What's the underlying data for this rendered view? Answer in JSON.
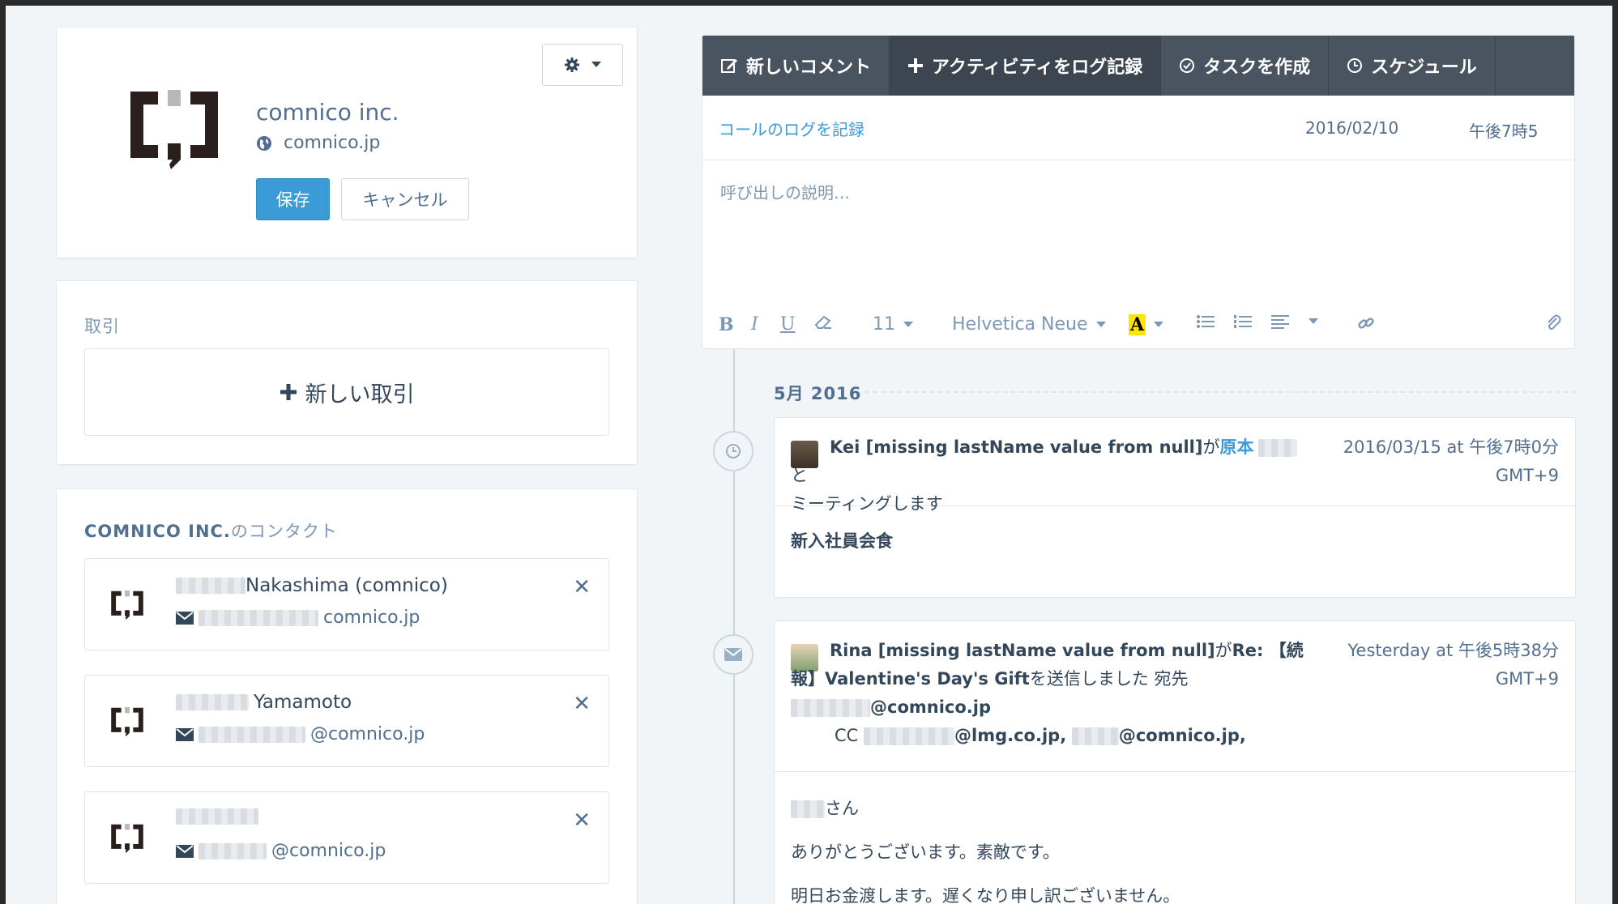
{
  "company": {
    "name": "comnico inc.",
    "domain": "comnico.jp",
    "save_label": "保存",
    "cancel_label": "キャンセル"
  },
  "deals": {
    "section_title": "取引",
    "new_deal_label": "新しい取引"
  },
  "contacts": {
    "section_title_strong": "COMNICO INC.",
    "section_title_rest": "のコンタクト",
    "items": [
      {
        "name": "Nakashima (comnico)",
        "email": "comnico.jp"
      },
      {
        "name": "Yamamoto",
        "email": "@comnico.jp"
      },
      {
        "name": "",
        "email": "@comnico.jp"
      }
    ]
  },
  "composer": {
    "tabs": [
      {
        "label": "新しいコメント",
        "icon": "edit-icon"
      },
      {
        "label": "アクティビティをログ記録",
        "icon": "plus-icon"
      },
      {
        "label": "タスクを作成",
        "icon": "check-circle-icon"
      },
      {
        "label": "スケジュール",
        "icon": "clock-icon"
      }
    ],
    "active_tab": 1,
    "log_call_link": "コールのログを記録",
    "date": "2016/02/10",
    "time": "午後7時5",
    "description_placeholder": "呼び出しの説明…",
    "toolbar": {
      "font_size": "11",
      "font_family": "Helvetica Neue"
    }
  },
  "timeline": {
    "month": "5月 2016",
    "events": [
      {
        "type": "meeting",
        "actor": "Kei [missing lastName value from null]",
        "particle": "が",
        "target": "原本",
        "action_tail": "と",
        "action_line2": "ミーティングします",
        "time_line1": "2016/03/15 at 午後7時0分",
        "time_line2": "GMT+9",
        "body": "新入社員会食"
      },
      {
        "type": "email",
        "actor": "Rina [missing lastName value from null]",
        "particle": "が",
        "subject_line1": "Re: 【続",
        "subject_line2": "報】Valentine's Day's Gift",
        "action": "を送信しました 宛先",
        "to": "@comnico.jp",
        "cc_label": "CC",
        "cc1": "@lmg.co.jp,",
        "cc2": "@comnico.jp,",
        "time_line1": "Yesterday at 午後5時38分",
        "time_line2": "GMT+9",
        "body_line1": "さん",
        "body_line2": "ありがとうございます。素敵です。",
        "body_line3": "明日お金渡します。遅くなり申し訳ございません。"
      }
    ]
  }
}
